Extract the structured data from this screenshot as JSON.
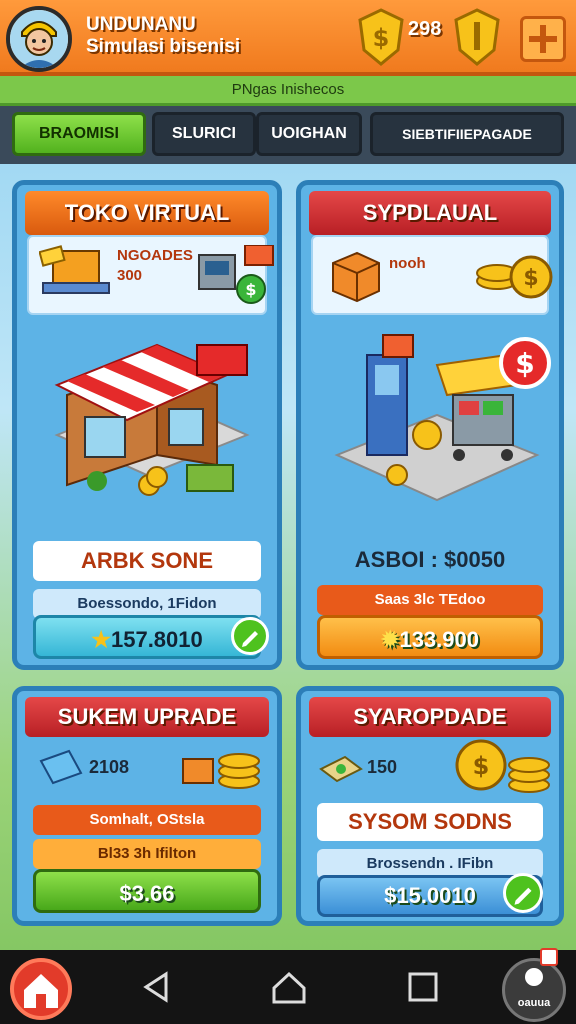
{
  "header": {
    "title_line1": "UNDUNANU",
    "title_line2": "Simulasi bisenisi",
    "coin_count": "298"
  },
  "strip": {
    "text": "PNgas Inishecos"
  },
  "tabs": [
    {
      "label": "BRAOMISI"
    },
    {
      "label": "SLURICI"
    },
    {
      "label": "UOIGHAN"
    },
    {
      "label": "SIEBTIFIIEPAGADE"
    }
  ],
  "cards": {
    "toko": {
      "title": "TOKO VIRTUAL",
      "info_text": "NGOADES",
      "info_sub": "300",
      "name_label": "ARBK SONE",
      "sub_label": "Boessondo, 1Fidon",
      "price": "157.8010"
    },
    "sypdl": {
      "title": "SYPDLAUAL",
      "info_text": "nooh",
      "info_sub": "",
      "name_label": "ASBOI : $0050",
      "sub_label": "Saas 3lc TEdoo",
      "price": "133.900"
    },
    "sukem": {
      "title": "SUKEM UPRADE",
      "count": "2108",
      "sub_label": "Somhalt, OStsla",
      "sub_label2": "Bl33 3h Ifilton",
      "price": "$3.66"
    },
    "syaro": {
      "title": "SYAROPDADE",
      "count": "150",
      "name_label": "SYSOM SODNS",
      "sub_label": "Brossendn . IFibn",
      "price": "$15.0010"
    }
  },
  "navbar": {
    "profile_label": "oauua"
  }
}
